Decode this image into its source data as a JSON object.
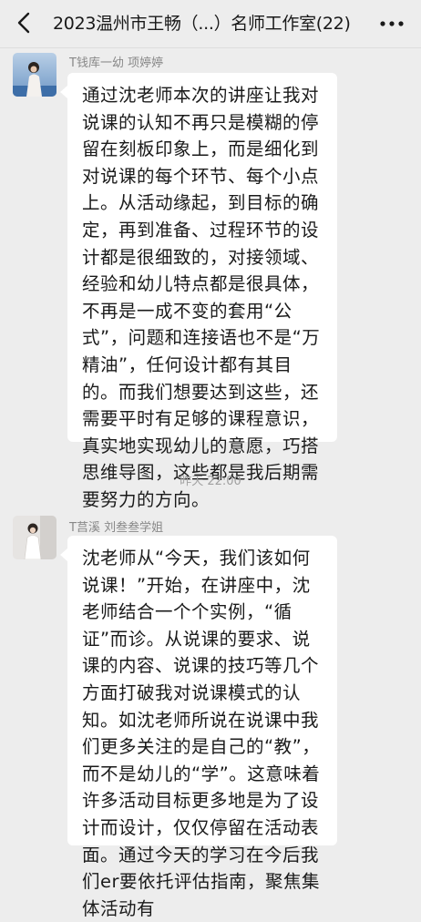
{
  "header": {
    "title": "2023温州市王畅（...）名师工作室(22)",
    "back_icon": "chevron-left-icon",
    "more_icon": "more-dots-icon"
  },
  "messages": [
    {
      "sender": "T钱库一幼 项婷婷",
      "text": "通过沈老师本次的讲座让我对说课的认知不再只是模糊的停留在刻板印象上，而是细化到对说课的每个环节、每个小点上。从活动缘起，到目标的确定，再到准备、过程环节的设计都是很细致的，对接领域、经验和幼儿特点都是很具体，不再是一成不变的套用“公式”，问题和连接语也不是“万精油”，任何设计都有其目的。而我们想要达到这些，还需要平时有足够的课程意识，真实地实现幼儿的意愿，巧搭思维导图，这些都是我后期需要努力的方向。"
    },
    {
      "sender": "T莒溪 刘叁叁学姐",
      "text": "沈老师从“今天，我们该如何说课！”开始，在讲座中，沈老师结合一个个实例，“循证”而诊。从说课的要求、说课的内容、说课的技巧等几个方面打破我对说课模式的认知。如沈老师所说在说课中我们更多关注的是自己的“教”，而不是幼儿的“学”。这意味着许多活动目标更多地是为了设计而设计，仅仅停留在活动表面。通过今天的学习在今后我们er要依托评估指南，聚焦集体活动有"
    }
  ],
  "timestamp": "昨天 22:00",
  "colors": {
    "background": "#ededed",
    "bubble": "#ffffff",
    "sender_name": "#888888",
    "timestamp": "#a0a0a0"
  }
}
